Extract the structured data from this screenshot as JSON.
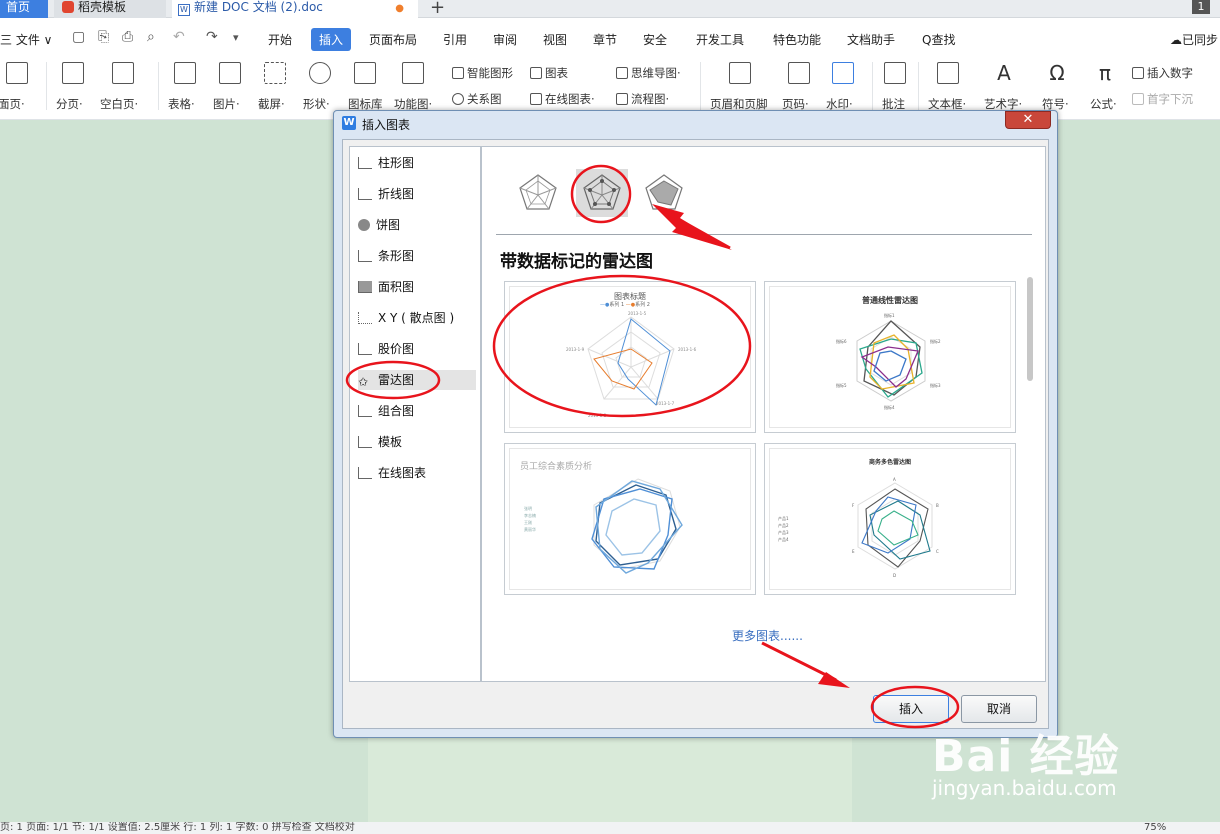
{
  "tabs": {
    "home": "首页",
    "daoke": "稻壳模板",
    "doc": "新建 DOC 文档 (2).doc",
    "doc_mark": "W",
    "unsaved_dot": "●",
    "plus": "+",
    "window_count": "1"
  },
  "menu": {
    "file": "三 文件 ∨",
    "items": [
      "开始",
      "插入",
      "页面布局",
      "引用",
      "审阅",
      "视图",
      "章节",
      "安全",
      "开发工具",
      "特色功能",
      "文档助手"
    ],
    "search": "Q查找",
    "sync": "已同步"
  },
  "ribbon": {
    "big": [
      "面页·",
      "分页·",
      "空白页·",
      "表格·",
      "图片·",
      "截屏·",
      "形状·",
      "图标库",
      "功能图·"
    ],
    "small_top": [
      "智能图形",
      "图表",
      "思维导图·"
    ],
    "small_bottom": [
      "关系图",
      "在线图表·",
      "流程图·"
    ],
    "big2": [
      "页眉和页脚",
      "页码·",
      "水印·",
      "批注",
      "文本框·",
      "艺术字·",
      "符号·",
      "公式·"
    ],
    "right_top": "插入数字",
    "right_bottom": "首字下沉"
  },
  "statusbar": {
    "text": "页: 1   页面: 1/1   节: 1/1   设置值: 2.5厘米   行: 1   列: 1   字数: 0   拼写检查   文档校对",
    "zoom": "75%"
  },
  "dialog": {
    "icon": "W",
    "title": "插入图表",
    "close": "✕",
    "categories": [
      "柱形图",
      "折线图",
      "饼图",
      "条形图",
      "面积图",
      "X Y ( 散点图 )",
      "股价图",
      "雷达图",
      "组合图",
      "模板",
      "在线图表"
    ],
    "selected_category": "雷达图",
    "chart_heading": "带数据标记的雷达图",
    "thumbnails": [
      {
        "title": "图表标题",
        "legend": [
          "系列 1",
          "系列 2"
        ],
        "axis": [
          "2013-1-5",
          "2013-1-6",
          "2013-1-7",
          "2013-1-8",
          "2013-1-9"
        ]
      },
      {
        "title": "普通线性雷达图",
        "axis": [
          "指标1",
          "指标2",
          "指标3",
          "指标4",
          "指标5",
          "指标6"
        ]
      },
      {
        "title": "员工综合素质分析",
        "legend": [
          "张明",
          "李志楠",
          "王刚",
          "黄丽华"
        ]
      },
      {
        "title": "商务多色雷达图",
        "legend": [
          "产品1",
          "产品2",
          "产品3",
          "产品4"
        ],
        "axis": [
          "A",
          "B",
          "C",
          "D",
          "E",
          "F"
        ]
      }
    ],
    "more_link": "更多图表......",
    "insert_button": "插入",
    "cancel_button": "取消"
  },
  "watermark": {
    "brand": "Bai 经验",
    "url": "jingyan.baidu.com"
  },
  "colors": {
    "accent": "#3d7fe0",
    "annotation_red": "#e8141c",
    "page_bg": "#cfe3d3"
  }
}
